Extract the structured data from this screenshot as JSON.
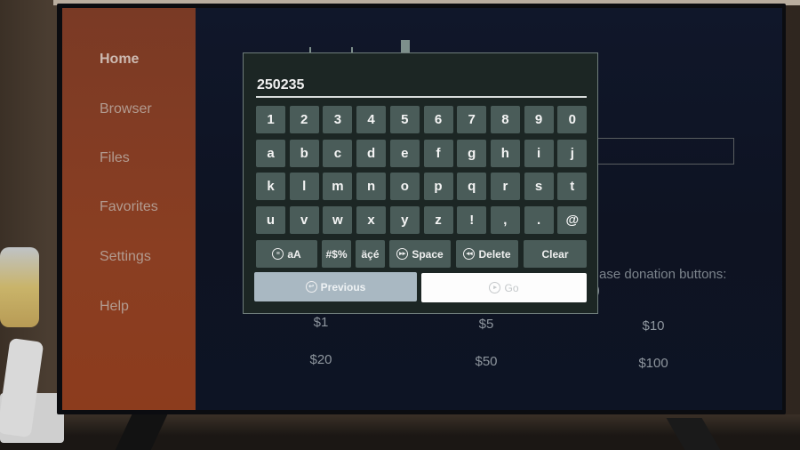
{
  "sidebar": {
    "items": [
      {
        "label": "Home",
        "active": true
      },
      {
        "label": "Browser",
        "active": false
      },
      {
        "label": "Files",
        "active": false
      },
      {
        "label": "Favorites",
        "active": false
      },
      {
        "label": "Settings",
        "active": false
      },
      {
        "label": "Help",
        "active": false
      }
    ]
  },
  "background": {
    "donation_text": "ase donation buttons:",
    "donation_text2": ")",
    "amounts": [
      "$1",
      "$5",
      "$10",
      "$20",
      "$50",
      "$100"
    ]
  },
  "keyboard": {
    "input_value": "250235",
    "rows": [
      [
        "1",
        "2",
        "3",
        "4",
        "5",
        "6",
        "7",
        "8",
        "9",
        "0"
      ],
      [
        "a",
        "b",
        "c",
        "d",
        "e",
        "f",
        "g",
        "h",
        "i",
        "j"
      ],
      [
        "k",
        "l",
        "m",
        "n",
        "o",
        "p",
        "q",
        "r",
        "s",
        "t"
      ],
      [
        "u",
        "v",
        "w",
        "x",
        "y",
        "z",
        "!",
        ",",
        ".",
        "@"
      ]
    ],
    "function_keys": {
      "case": "aA",
      "case_icon": "menu-button-icon",
      "symbols": "#$%",
      "accents": "äçé",
      "space": "Space",
      "space_icon": "fast-forward-button-icon",
      "delete": "Delete",
      "delete_icon": "rewind-button-icon",
      "clear": "Clear"
    },
    "previous_label": "Previous",
    "previous_icon": "back-button-icon",
    "go_label": "Go",
    "go_icon": "play-pause-button-icon"
  },
  "colors": {
    "sidebar": "#8a3e22",
    "key": "#4a5c59",
    "dialog": "#1c2624",
    "previous": "#a9b8c2",
    "go": "#fdfdfd"
  }
}
